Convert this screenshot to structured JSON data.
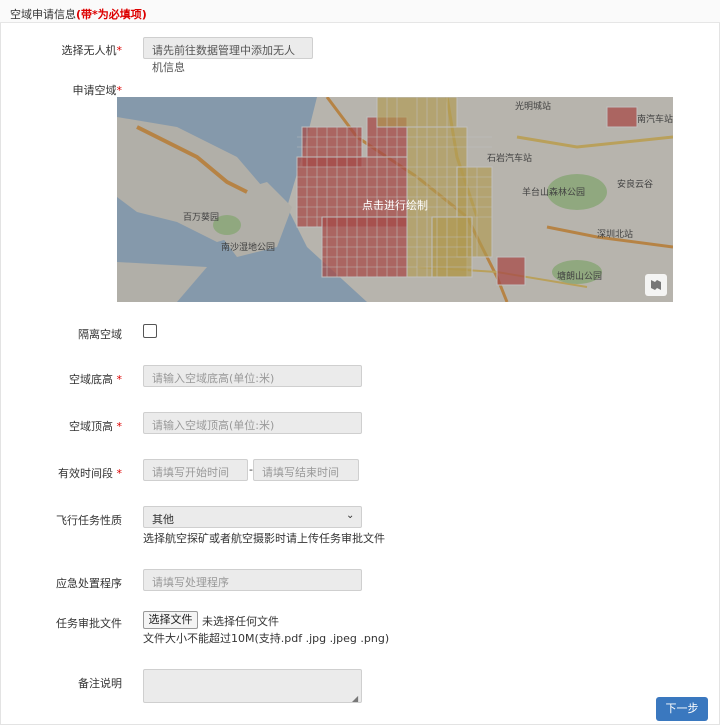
{
  "header": {
    "title": "空域申请信息",
    "required_note": "(带*为必填项)"
  },
  "form": {
    "drone": {
      "label": "选择无人机",
      "star": "*",
      "text_line1": "请先前往数据管理中添加无人",
      "text_line2": "机信息"
    },
    "airspace": {
      "label": "申请空域",
      "star": "*",
      "map": {
        "center_text": "点击进行绘制",
        "labels": [
          "光明城站",
          "百万葵园",
          "南沙湿地公园",
          "石岩汽车站",
          "羊台山森林公园",
          "深圳北站",
          "塘朗山公园",
          "安良云谷",
          "南汽车站"
        ],
        "layer_icon": "map-layers-icon"
      }
    },
    "isolation": {
      "label": "隔离空域",
      "checked": false
    },
    "floor": {
      "label": "空域底高",
      "star": "*",
      "placeholder": "请输入空域底高(单位:米)"
    },
    "ceiling": {
      "label": "空域顶高",
      "star": "*",
      "placeholder": "请输入空域顶高(单位:米)"
    },
    "period": {
      "label": "有效时间段",
      "star": "*",
      "start_placeholder": "请填写开始时间",
      "separator": "-",
      "end_placeholder": "请填写结束时间"
    },
    "mission_type": {
      "label": "飞行任务性质",
      "value": "其他",
      "hint": "选择航空探矿或者航空摄影时请上传任务审批文件"
    },
    "emergency": {
      "label": "应急处置程序",
      "placeholder": "请填写处理程序"
    },
    "approval_file": {
      "label": "任务审批文件",
      "button": "选择文件",
      "status": "未选择任何文件",
      "hint": "文件大小不能超过10M(支持.pdf .jpg .jpeg .png)"
    },
    "remarks": {
      "label": "备注说明"
    }
  },
  "actions": {
    "next": "下一步"
  },
  "colors": {
    "required": "#dd0000",
    "primary_button": "#3a78bf",
    "input_bg": "#ebebeb",
    "grid_red": "#d9534f",
    "grid_yellow": "#e8c65a"
  }
}
